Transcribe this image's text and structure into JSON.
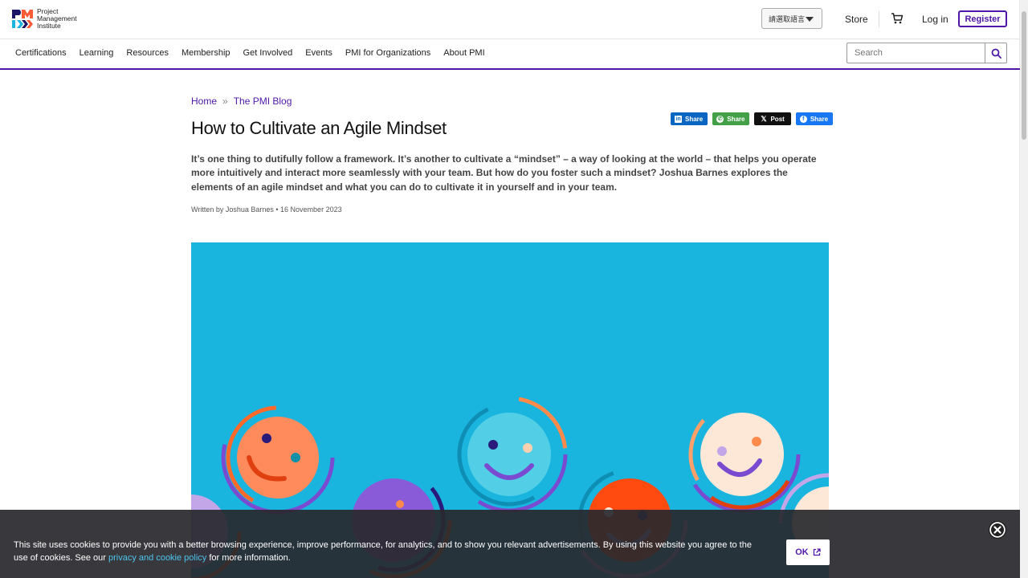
{
  "header": {
    "logo_lines": [
      "Project",
      "Management",
      "Institute"
    ],
    "language_label": "請選取語言",
    "store_label": "Store",
    "login_label": "Log in",
    "register_label": "Register"
  },
  "nav": {
    "items": [
      "Certifications",
      "Learning",
      "Resources",
      "Membership",
      "Get Involved",
      "Events",
      "PMI for Organizations",
      "About PMI"
    ],
    "search_placeholder": "Search"
  },
  "breadcrumb": {
    "home": "Home",
    "separator": "»",
    "current": "The PMI Blog"
  },
  "article": {
    "title": "How to Cultivate an Agile Mindset",
    "lead": "It’s one thing to dutifully follow a framework. It’s another to cultivate a “mindset” – a way of looking at the world – that helps you operate more intuitively and interact more seamlessly with your team. But how do you foster such a mindset? Joshua Barnes explores the elements of an agile mindset and what you can do to cultivate it in yourself and in your team.",
    "byline": "Written by Joshua Barnes • 16 November 2023"
  },
  "share": {
    "linkedin": "Share",
    "whatsapp": "Share",
    "x": "Post",
    "facebook": "Share"
  },
  "cookie": {
    "text_before": "This site uses cookies to provide you with a better browsing experience, improve performance, for analytics, and to show you relevant advertisements. By using this website you agree to the use of cookies. See our ",
    "link": "privacy and cookie policy",
    "text_after": " for more information.",
    "ok_label": "OK"
  },
  "colors": {
    "brand": "#4f17a8",
    "hero_bg": "#19b5df",
    "linkedin": "#0a66c2",
    "whatsapp": "#43a047",
    "x": "#111111",
    "facebook": "#1877f2"
  }
}
